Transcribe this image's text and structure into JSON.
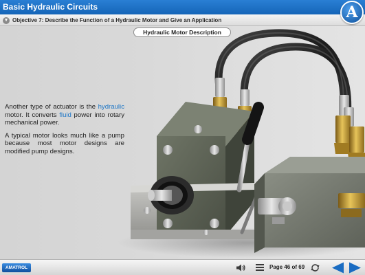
{
  "header": {
    "title": "Basic Hydraulic Circuits",
    "logo_letter": "A"
  },
  "objective": {
    "text": "Objective 7: Describe the Function of a Hydraulic Motor and Give an Application"
  },
  "slide": {
    "heading": "Hydraulic Motor Description",
    "p1_a": "Another type of actuator is the ",
    "p1_kw1": "hydraulic",
    "p1_b": " motor. It converts ",
    "p1_kw2": "fluid",
    "p1_c": " power into rotary mechanical power.",
    "p2": "A typical motor looks much like a pump because most motor designs are modified pump designs."
  },
  "footer": {
    "brand": "AMATROL",
    "page": "Page 46 of 69"
  },
  "icons": {
    "sound": "speaker-icon",
    "menu": "hamburger-menu-icon",
    "reload": "reload-icon",
    "back": "back-arrow-icon",
    "next": "next-arrow-icon"
  },
  "colors": {
    "title_bar": "#1a6cc2",
    "keyword": "#1f77c6",
    "nav_arrow": "#1a6cc2"
  }
}
